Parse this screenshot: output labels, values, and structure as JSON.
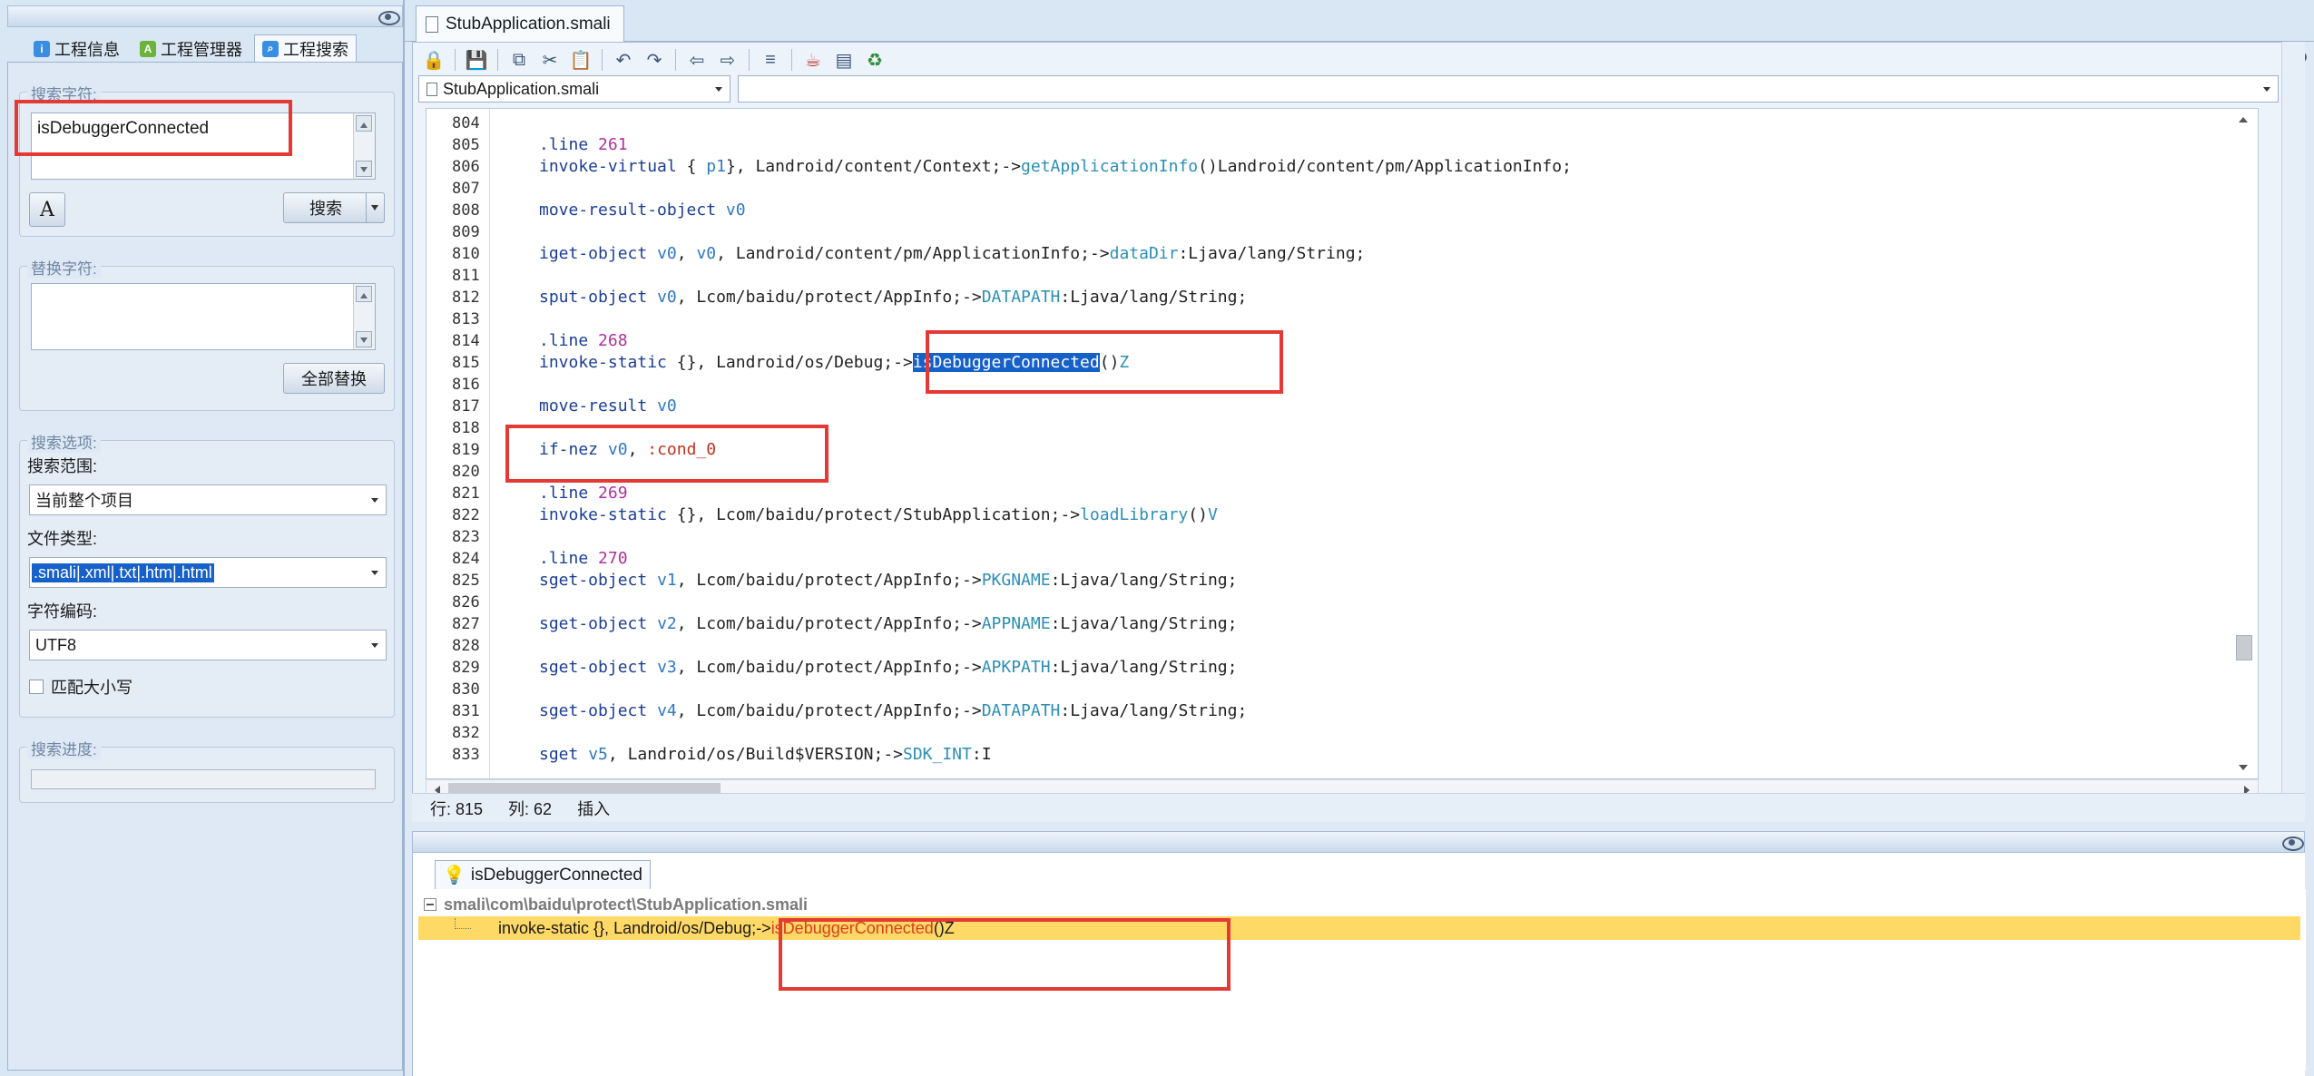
{
  "left": {
    "tabs": [
      {
        "label": "工程信息",
        "icon": "info-icon"
      },
      {
        "label": "工程管理器",
        "icon": "android-icon"
      },
      {
        "label": "工程搜索",
        "icon": "search-icon"
      }
    ],
    "search": {
      "group_title": "搜索字符:",
      "value": "isDebuggerConnected",
      "button": "搜索"
    },
    "replace": {
      "group_title": "替换字符:",
      "value": "",
      "button": "全部替换"
    },
    "options": {
      "group_title": "搜索选项:",
      "scope_label": "搜索范围:",
      "scope_value": "当前整个项目",
      "filetype_label": "文件类型:",
      "filetype_value": ".smali|.xml|.txt|.htm|.html",
      "encoding_label": "字符编码:",
      "encoding_value": "UTF8",
      "match_case_label": "匹配大小写",
      "match_case_checked": false
    },
    "progress": {
      "group_title": "搜索进度:",
      "value": 0
    }
  },
  "editor": {
    "tab_label": "StubApplication.smali",
    "file_combo": "StubApplication.smali",
    "member_combo": "",
    "lines": [
      {
        "n": "804"
      },
      {
        "n": "805"
      },
      {
        "n": "806"
      },
      {
        "n": "807"
      },
      {
        "n": "808"
      },
      {
        "n": "809"
      },
      {
        "n": "810"
      },
      {
        "n": "811"
      },
      {
        "n": "812"
      },
      {
        "n": "813"
      },
      {
        "n": "814"
      },
      {
        "n": "815"
      },
      {
        "n": "816"
      },
      {
        "n": "817"
      },
      {
        "n": "818"
      },
      {
        "n": "819"
      },
      {
        "n": "820"
      },
      {
        "n": "821"
      },
      {
        "n": "822"
      },
      {
        "n": "823"
      },
      {
        "n": "824"
      },
      {
        "n": "825"
      },
      {
        "n": "826"
      },
      {
        "n": "827"
      },
      {
        "n": "828"
      },
      {
        "n": "829"
      },
      {
        "n": "830"
      },
      {
        "n": "831"
      },
      {
        "n": "832"
      },
      {
        "n": "833"
      }
    ],
    "code": {
      "l805": {
        "kw": ".line",
        "num": "261"
      },
      "l806": {
        "kw": "invoke-virtual",
        "a": "{",
        "r": "p1",
        "b": "}, Landroid/content/Context;->",
        "m": "getApplicationInfo",
        "c": "()Landroid/content/pm/ApplicationInfo;"
      },
      "l808": {
        "kw": "move-result-object",
        "r": "v0"
      },
      "l810": {
        "kw": "iget-object",
        "r": "v0",
        "b": ",",
        "r2": "v0",
        "c": ", Landroid/content/pm/ApplicationInfo;->",
        "m": "dataDir",
        "d": ":Ljava/lang/String;"
      },
      "l812": {
        "kw": "sput-object",
        "r": "v0",
        "b": ", Lcom/baidu/protect/AppInfo;->",
        "m": "DATAPATH",
        "d": ":Ljava/lang/String;"
      },
      "l814": {
        "kw": ".line",
        "num": "268"
      },
      "l815": {
        "kw": "invoke-static",
        "b": "{}, Landroid/os/Debug;->",
        "m": "isDebuggerConnected",
        "c": "()",
        "d": "Z"
      },
      "l817": {
        "kw": "move-result",
        "r": "v0"
      },
      "l819": {
        "kw": "if-nez",
        "r": "v0",
        "b": ",",
        "lbl": ":cond_0"
      },
      "l821": {
        "kw": ".line",
        "num": "269"
      },
      "l822": {
        "kw": "invoke-static",
        "b": "{}, Lcom/baidu/protect/StubApplication;->",
        "m": "loadLibrary",
        "c": "()",
        "d": "V"
      },
      "l824": {
        "kw": ".line",
        "num": "270"
      },
      "l825": {
        "kw": "sget-object",
        "r": "v1",
        "b": ", Lcom/baidu/protect/AppInfo;->",
        "m": "PKGNAME",
        "d": ":Ljava/lang/String;"
      },
      "l827": {
        "kw": "sget-object",
        "r": "v2",
        "b": ", Lcom/baidu/protect/AppInfo;->",
        "m": "APPNAME",
        "d": ":Ljava/lang/String;"
      },
      "l829": {
        "kw": "sget-object",
        "r": "v3",
        "b": ", Lcom/baidu/protect/AppInfo;->",
        "m": "APKPATH",
        "d": ":Ljava/lang/String;"
      },
      "l831": {
        "kw": "sget-object",
        "r": "v4",
        "b": ", Lcom/baidu/protect/AppInfo;->",
        "m": "DATAPATH",
        "d": ":Ljava/lang/String;"
      },
      "l833": {
        "kw": "sget",
        "r": "v5",
        "b": ", Landroid/os/Build$VERSION;->",
        "m": "SDK_INT",
        "d": ":I"
      }
    },
    "status": {
      "row": "行: 815",
      "col": "列: 62",
      "mode": "插入"
    }
  },
  "results": {
    "tab_label": "isDebuggerConnected",
    "file_path": "smali\\com\\baidu\\protect\\StubApplication.smali",
    "match_prefix": "invoke-static {}, Landroid/os/Debug;->",
    "match_hit": "isDebuggerConnected",
    "match_suffix": "()Z"
  },
  "colors": {
    "highlight_box": "#e53935",
    "selection": "#1660c9",
    "result_row": "#ffd966"
  }
}
